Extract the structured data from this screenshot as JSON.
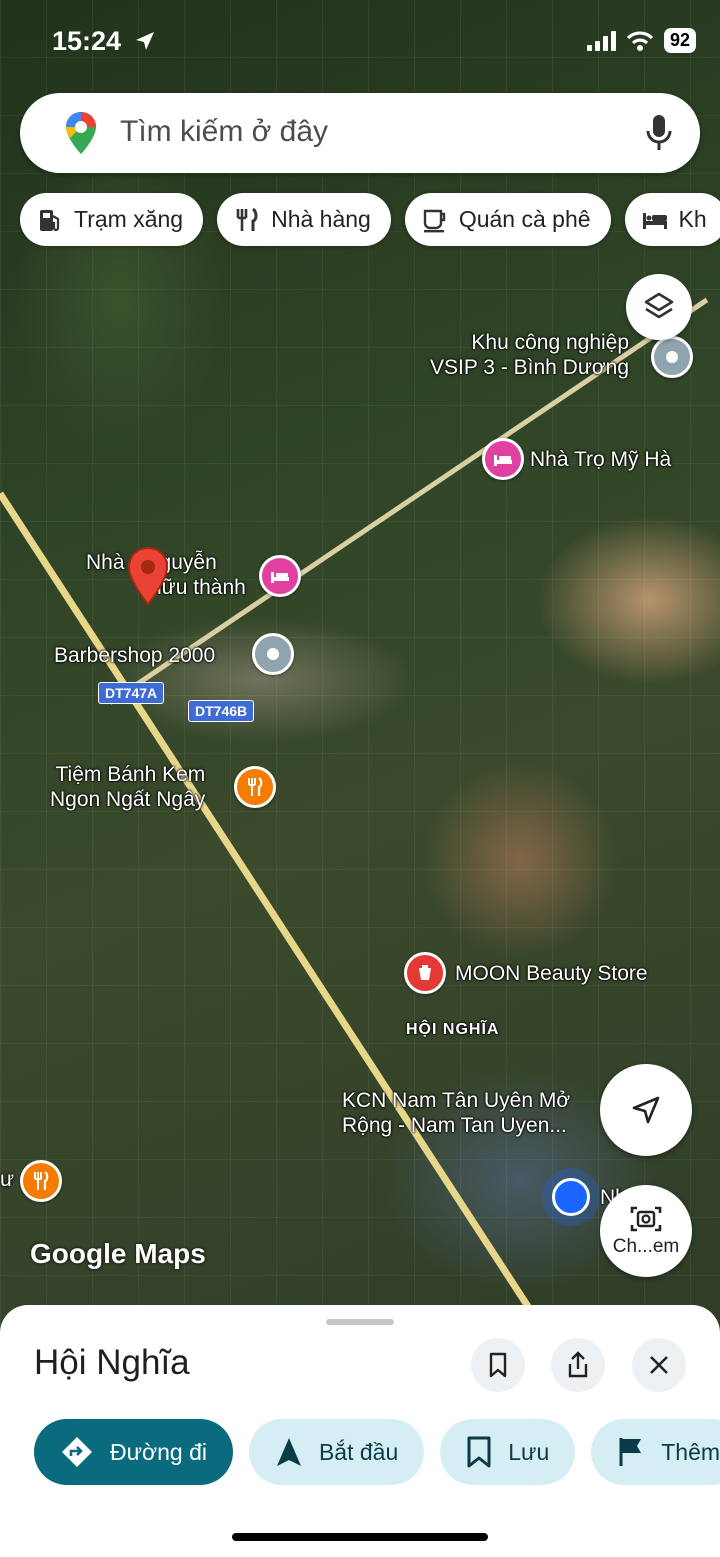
{
  "status_bar": {
    "time": "15:24",
    "battery": "92"
  },
  "search": {
    "placeholder": "Tìm kiếm ở đây"
  },
  "chips": [
    {
      "label": "Trạm xăng",
      "icon": "gas-station-icon"
    },
    {
      "label": "Nhà hàng",
      "icon": "restaurant-icon"
    },
    {
      "label": "Quán cà phê",
      "icon": "coffee-icon"
    },
    {
      "label": "Kh",
      "icon": "hotel-icon"
    }
  ],
  "map_labels": {
    "vsip_line1": "Khu công nghiệp",
    "vsip_line2": "VSIP 3 - Bình Dương",
    "nha_tro": "Nhà Trọ Mỹ Hà",
    "nha_nguyen_line1": "Nhà    nguyễn",
    "nha_nguyen_line2": "hữu thành",
    "barbershop": "Barbershop 2000",
    "road_a": "DT747A",
    "road_b": "DT746B",
    "tiem_banh_line1": "Tiệm Bánh Kem",
    "tiem_banh_line2": "Ngon Ngất Ngây",
    "moon": "MOON Beauty Store",
    "area": "HỘI NGHĨA",
    "kcn_line1": "KCN Nam Tân Uyên Mở",
    "kcn_line2": "Rộng - Nam Tan Uyen...",
    "partial_right": "Nh...ng",
    "partial_left": "ư",
    "google_maps": "Google Maps"
  },
  "camera_button": {
    "label": "Ch...em"
  },
  "place_sheet": {
    "title": "Hội Nghĩa",
    "actions": [
      {
        "label": "Đường đi",
        "icon": "directions-icon"
      },
      {
        "label": "Bắt đầu",
        "icon": "navigation-arrow-icon"
      },
      {
        "label": "Lưu",
        "icon": "bookmark-icon"
      },
      {
        "label": "Thêm",
        "icon": "flag-icon"
      }
    ]
  },
  "colors": {
    "primary": "#0b6b7e",
    "secondary_bg": "#d5eef4",
    "hotel_pin": "#e040a0",
    "food_pin": "#f57c00",
    "beauty_pin": "#e53935",
    "gray_pin": "#90a4ae"
  }
}
